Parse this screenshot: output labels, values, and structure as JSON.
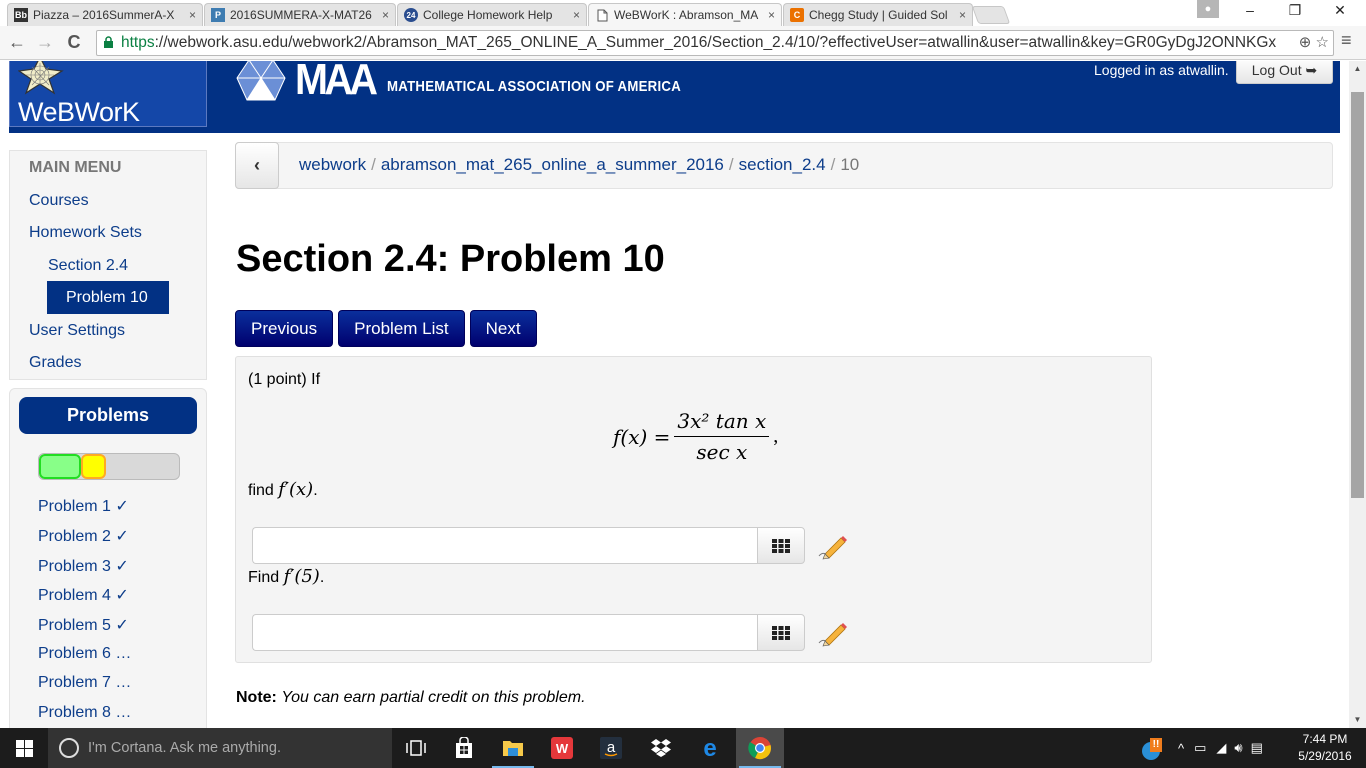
{
  "browser": {
    "tabs": [
      {
        "title": "Piazza – 2016SummerA-X",
        "favicon": "Bb",
        "favicon_color": "#333333",
        "active": false
      },
      {
        "title": "2016SUMMERA-X-MAT26",
        "favicon": "P",
        "favicon_color": "#3e7cb1",
        "active": false
      },
      {
        "title": "College Homework Help",
        "favicon": "24",
        "favicon_color": "#2a4d8f",
        "active": false
      },
      {
        "title": "WeBWorK : Abramson_MA",
        "favicon": "doc",
        "favicon_color": "#ffffff",
        "active": true
      },
      {
        "title": "Chegg Study | Guided Sol",
        "favicon": "C",
        "favicon_color": "#eb7100",
        "active": false
      }
    ],
    "tab_close_glyph": "×",
    "window_controls": {
      "minimize": "–",
      "restore": "❐",
      "close": "✕"
    },
    "nav": {
      "back": "←",
      "forward": "→",
      "reload": "C"
    },
    "url": {
      "scheme": "https",
      "rest": "://webwork.asu.edu/webwork2/Abramson_MAT_265_ONLINE_A_Summer_2016/Section_2.4/10/?effectiveUser=atwallin&user=atwallin&key=GR0GyDgJ2ONNKGx"
    },
    "omnibox_icons": [
      "zoom-icon",
      "star-icon"
    ],
    "menu_glyph": "≡"
  },
  "header": {
    "logo_text": "WeBWorK",
    "maa_mark": "MAA",
    "maa_name": "MATHEMATICAL ASSOCIATION OF AMERICA",
    "login_status": "Logged in as atwallin.",
    "logout_label": "Log Out",
    "brand_color": "#023184"
  },
  "main_menu": {
    "heading": "MAIN MENU",
    "items": [
      {
        "label": "Courses",
        "level": 0
      },
      {
        "label": "Homework Sets",
        "level": 0
      },
      {
        "label": "Section 2.4",
        "level": 1
      },
      {
        "label": "Problem 10",
        "level": 2,
        "active": true
      },
      {
        "label": "User Settings",
        "level": 0
      },
      {
        "label": "Grades",
        "level": 0
      }
    ]
  },
  "problems_panel": {
    "heading": "Problems",
    "progress": {
      "correct_fraction": 0.3,
      "partial_fraction": 0.18
    },
    "colors": {
      "correct": "#88ff88",
      "partial": "#ffff00",
      "remaining": "#d9d9d9"
    },
    "items": [
      {
        "label": "Problem 1 ✓"
      },
      {
        "label": "Problem 2 ✓"
      },
      {
        "label": "Problem 3 ✓"
      },
      {
        "label": "Problem 4 ✓"
      },
      {
        "label": "Problem 5 ✓"
      },
      {
        "label": "Problem 6 …"
      },
      {
        "label": "Problem 7 …"
      },
      {
        "label": "Problem 8 …"
      }
    ]
  },
  "breadcrumb": {
    "back_glyph": "‹",
    "items": [
      "webwork",
      "abramson_mat_265_online_a_summer_2016",
      "section_2.4"
    ],
    "current": "10",
    "separator": "/"
  },
  "page": {
    "title": "Section 2.4: Problem 10",
    "nav_buttons": [
      "Previous",
      "Problem List",
      "Next"
    ]
  },
  "problem": {
    "intro": "(1 point) If",
    "formula": {
      "lhs": "f(x) =",
      "numerator": "3x² tan x",
      "denominator": "sec x",
      "trail": ","
    },
    "parts": [
      {
        "prompt_text": "find",
        "prompt_math": "f′(x)",
        "prompt_end": ".",
        "answer_value": "",
        "answer_placeholder": ""
      },
      {
        "prompt_text": "Find",
        "prompt_math": "f′(5)",
        "prompt_end": ".",
        "answer_value": "",
        "answer_placeholder": ""
      }
    ]
  },
  "note": {
    "label": "Note:",
    "text": "You can earn partial credit on this problem."
  },
  "taskbar": {
    "cortana_placeholder": "I'm Cortana. Ask me anything.",
    "pinned": [
      "task-view",
      "store",
      "file-explorer",
      "wps-office",
      "amazon",
      "dropbox",
      "edge",
      "chrome"
    ],
    "time": "7:44 PM",
    "date": "5/29/2016"
  }
}
